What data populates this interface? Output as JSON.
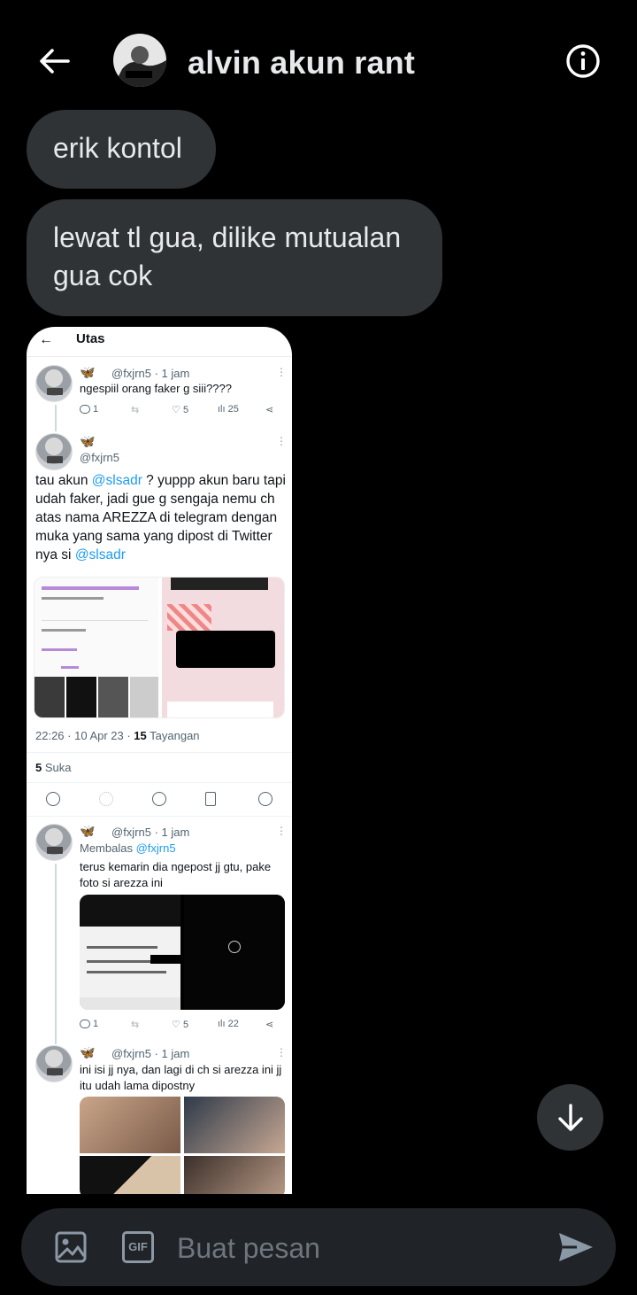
{
  "header": {
    "title": "alvin akun rant",
    "back_icon": "arrow-left-icon",
    "info_icon": "info-icon"
  },
  "messages": [
    {
      "text": "erik kontol"
    },
    {
      "text": "lewat tl gua, dilike mutualan gua cok"
    }
  ],
  "attachment": {
    "topbar_title": "Utas",
    "tweets": [
      {
        "meta": "@fxjrn5 · 1 jam",
        "text": "ngespiil orang faker g siii????",
        "replies": "1",
        "likes": "5",
        "views": "25"
      },
      {
        "handle": "@fxjrn5",
        "text_parts": [
          "tau akun ",
          "@slsadr",
          " ? yuppp akun baru tapi udah faker, jadi gue g sengaja nemu ch atas nama AREZZA di telegram dengan muka yang sama yang dipost di Twitter nya si ",
          "@slsadr"
        ],
        "timestamp": "22:26 · 10 Apr 23 · ",
        "views_count": "15",
        "views_label": " Tayangan",
        "likes_count": "5",
        "likes_label": " Suka"
      },
      {
        "meta": "@fxjrn5 · 1 jam",
        "reply_prefix": "Membalas ",
        "reply_to": "@fxjrn5",
        "text": "terus kemarin dia ngepost jj gtu, pake foto si arezza ini",
        "replies": "1",
        "likes": "5",
        "views": "22"
      },
      {
        "meta": "@fxjrn5 · 1 jam",
        "text": "ini isi jj nya, dan lagi di ch si arezza ini jj itu udah lama dipostny"
      }
    ]
  },
  "composer": {
    "placeholder": "Buat pesan",
    "gif_label": "GIF"
  },
  "colors": {
    "background": "#000000",
    "bubble": "#2f3336",
    "accent": "#1d9bf0",
    "composer": "#202327"
  }
}
